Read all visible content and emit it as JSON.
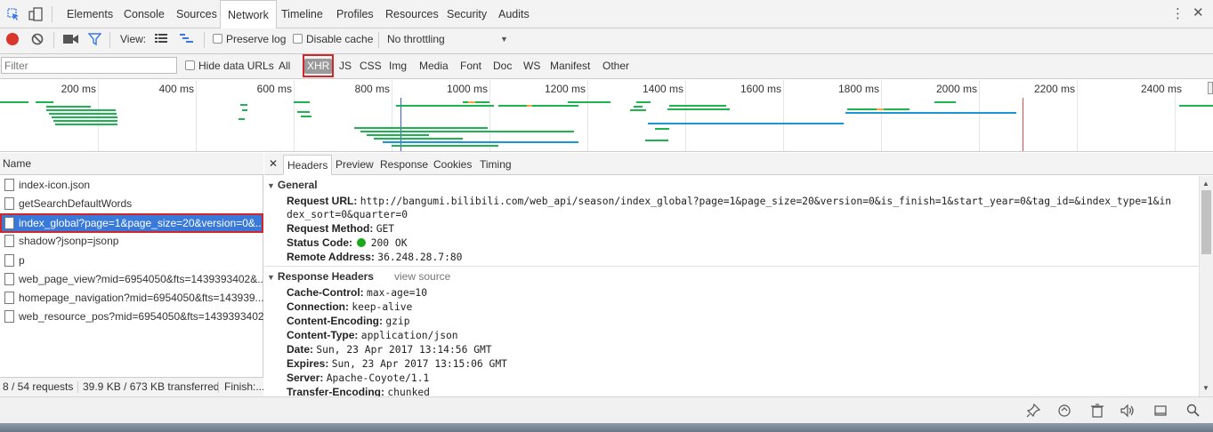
{
  "tabs": [
    {
      "label": "Elements"
    },
    {
      "label": "Console"
    },
    {
      "label": "Sources"
    },
    {
      "label": "Network"
    },
    {
      "label": "Timeline"
    },
    {
      "label": "Profiles"
    },
    {
      "label": "Resources"
    },
    {
      "label": "Security"
    },
    {
      "label": "Audits"
    }
  ],
  "toolbar": {
    "view_label": "View:",
    "preserve_log": "Preserve log",
    "disable_cache": "Disable cache",
    "throttling": "No throttling"
  },
  "filter": {
    "placeholder": "Filter",
    "hide_data_urls": "Hide data URLs",
    "types": [
      "All",
      "XHR",
      "JS",
      "CSS",
      "Img",
      "Media",
      "Font",
      "Doc",
      "WS",
      "Manifest",
      "Other"
    ],
    "selected": "XHR"
  },
  "timeline": {
    "ticks": [
      "200 ms",
      "400 ms",
      "600 ms",
      "800 ms",
      "1000 ms",
      "1200 ms",
      "1400 ms",
      "1600 ms",
      "1800 ms",
      "2000 ms",
      "2200 ms",
      "2400 ms"
    ]
  },
  "requests": {
    "column": "Name",
    "items": [
      "index-icon.json",
      "getSearchDefaultWords",
      "index_global?page=1&page_size=20&version=0&...",
      "shadow?jsonp=jsonp",
      "p",
      "web_page_view?mid=6954050&fts=1439393402&...",
      "homepage_navigation?mid=6954050&fts=143939...",
      "web_resource_pos?mid=6954050&fts=1439393402..."
    ],
    "selected_index": 2,
    "summary": "8 / 54 requests",
    "transferred": "39.9 KB / 673 KB transferred",
    "finish": "Finish:..."
  },
  "detail": {
    "tabs": [
      "Headers",
      "Preview",
      "Response",
      "Cookies",
      "Timing"
    ],
    "general_title": "General",
    "general": [
      {
        "k": "Request URL:",
        "v": "http://bangumi.bilibili.com/web_api/season/index_global?page=1&page_size=20&version=0&is_finish=1&start_year=0&tag_id=&index_type=1&in"
      },
      {
        "k": "",
        "v": "dex_sort=0&quarter=0"
      },
      {
        "k": "Request Method:",
        "v": "GET"
      },
      {
        "k": "Status Code:",
        "v": "200 OK"
      },
      {
        "k": "Remote Address:",
        "v": "36.248.28.7:80"
      }
    ],
    "response_title": "Response Headers",
    "view_source": "view source",
    "response": [
      {
        "k": "Cache-Control:",
        "v": "max-age=10"
      },
      {
        "k": "Connection:",
        "v": "keep-alive"
      },
      {
        "k": "Content-Encoding:",
        "v": "gzip"
      },
      {
        "k": "Content-Type:",
        "v": "application/json"
      },
      {
        "k": "Date:",
        "v": "Sun, 23 Apr 2017 13:14:56 GMT"
      },
      {
        "k": "Expires:",
        "v": "Sun, 23 Apr 2017 13:15:06 GMT"
      },
      {
        "k": "Server:",
        "v": "Apache-Coyote/1.1"
      },
      {
        "k": "Transfer-Encoding:",
        "v": "chunked"
      }
    ]
  },
  "colors": {
    "accent": "#3879d9",
    "highlight": "#d4262a",
    "status_ok": "#1aa81a",
    "bar_green": "#1db34f",
    "bar_blue": "#1a96d6"
  }
}
